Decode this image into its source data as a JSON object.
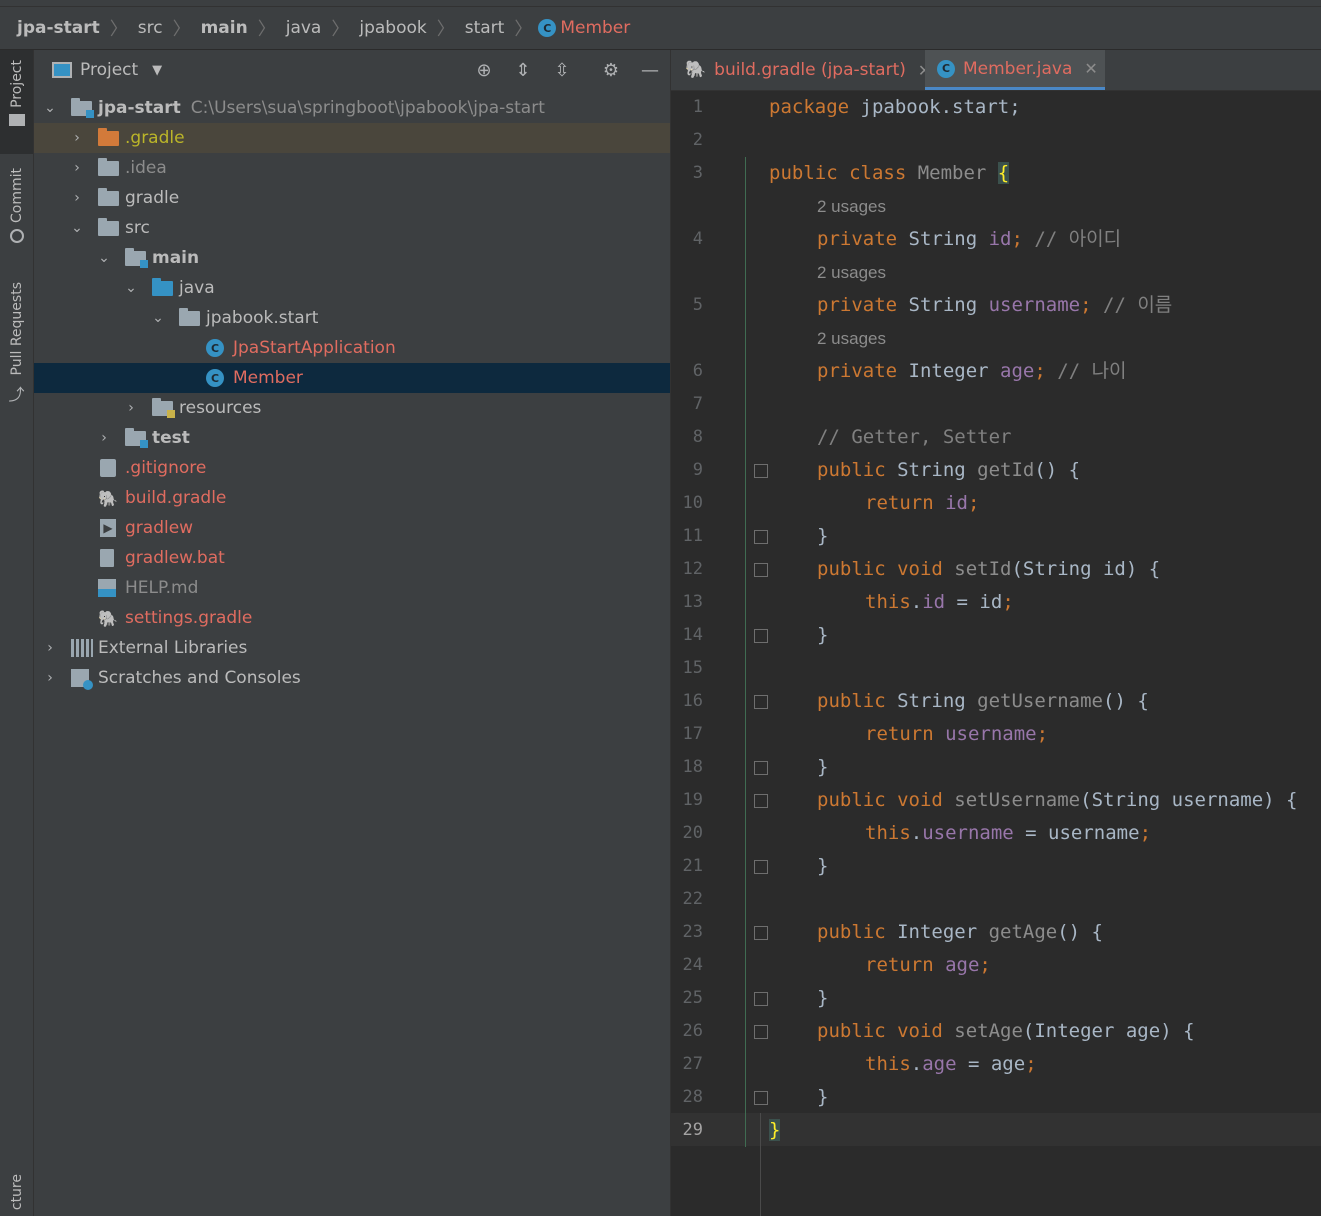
{
  "breadcrumb": {
    "items": [
      "jpa-start",
      "src",
      "main",
      "java",
      "jpabook",
      "start"
    ],
    "active": "Member",
    "active_icon": "class-c-icon",
    "class_letter": "C"
  },
  "left_toolbar": {
    "tabs": [
      "Project",
      "Commit",
      "Pull Requests",
      "cture"
    ]
  },
  "project_panel": {
    "title": "Project",
    "tree": {
      "root_name": "jpa-start",
      "root_path": "C:\\Users\\sua\\springboot\\jpabook\\jpa-start",
      "gradle_dir": ".gradle",
      "idea_dir": ".idea",
      "gradle": "gradle",
      "src": "src",
      "main": "main",
      "java": "java",
      "package": "jpabook.start",
      "app_class": "JpaStartApplication",
      "member_class": "Member",
      "resources": "resources",
      "test": "test",
      "gitignore": ".gitignore",
      "build_gradle": "build.gradle",
      "gradlew": "gradlew",
      "gradlew_bat": "gradlew.bat",
      "help_md": "HELP.md",
      "settings_gradle": "settings.gradle",
      "external_libraries": "External Libraries",
      "scratches": "Scratches and Consoles"
    }
  },
  "editor": {
    "tabs": [
      {
        "label": "build.gradle (jpa-start)",
        "icon": "gradle-elephant-icon"
      },
      {
        "label": "Member.java",
        "icon": "class-c-icon"
      }
    ],
    "current_line": "29",
    "line_numbers": [
      "1",
      "2",
      "3",
      "4",
      "5",
      "6",
      "7",
      "8",
      "9",
      "10",
      "11",
      "12",
      "13",
      "14",
      "15",
      "16",
      "17",
      "18",
      "19",
      "20",
      "21",
      "22",
      "23",
      "24",
      "25",
      "26",
      "27",
      "28",
      "29"
    ],
    "usage_hint": "2 usages",
    "code": {
      "l1_kw": "package",
      "l1_rest": " jpabook.start;",
      "l3_kw": "public class",
      "l3_name": " Member ",
      "l3_brace": "{",
      "l4_kw": "private",
      "l4_type": " String ",
      "l4_field": "id",
      "l4_semi": ";",
      "l4_cmt": " // 아이디",
      "l5_kw": "private",
      "l5_type": " String ",
      "l5_field": "username",
      "l5_semi": ";",
      "l5_cmt": " // 이름",
      "l6_kw": "private",
      "l6_type": " Integer ",
      "l6_field": "age",
      "l6_semi": ";",
      "l6_cmt": " // 나이",
      "l8_cmt": "// Getter, Setter",
      "l9_kw": "public",
      "l9_type": " String ",
      "l9_mth": "getId",
      "l9_rest": "() {",
      "l10_kw": "return",
      "l10_fld": " id",
      "l10_semi": ";",
      "close_brace": "}",
      "l12_kw": "public void",
      "l12_mth": " setId",
      "l12_rest": "(String id) {",
      "l13_kw": "this",
      "l13_dot": ".",
      "l13_fld": "id",
      "l13_rest": " = id",
      "l13_semi": ";",
      "l16_kw": "public",
      "l16_type": " String ",
      "l16_mth": "getUsername",
      "l16_rest": "() {",
      "l17_kw": "return",
      "l17_fld": " username",
      "l17_semi": ";",
      "l19_kw": "public void",
      "l19_mth": " setUsername",
      "l19_rest": "(String username) {",
      "l20_kw": "this",
      "l20_dot": ".",
      "l20_fld": "username",
      "l20_rest": " = username",
      "l20_semi": ";",
      "l23_kw": "public",
      "l23_type": " Integer ",
      "l23_mth": "getAge",
      "l23_rest": "() {",
      "l24_kw": "return",
      "l24_fld": " age",
      "l24_semi": ";",
      "l26_kw": "public void",
      "l26_mth": " setAge",
      "l26_rest": "(Integer age) {",
      "l27_kw": "this",
      "l27_dot": ".",
      "l27_fld": "age",
      "l27_rest": " = age",
      "l27_semi": ";",
      "l29_brace": "}"
    }
  },
  "colors": {
    "keyword": "#cc7832",
    "field": "#9876aa",
    "comment": "#808080",
    "modified_file": "#e06c60",
    "selection": "#0d293e"
  }
}
